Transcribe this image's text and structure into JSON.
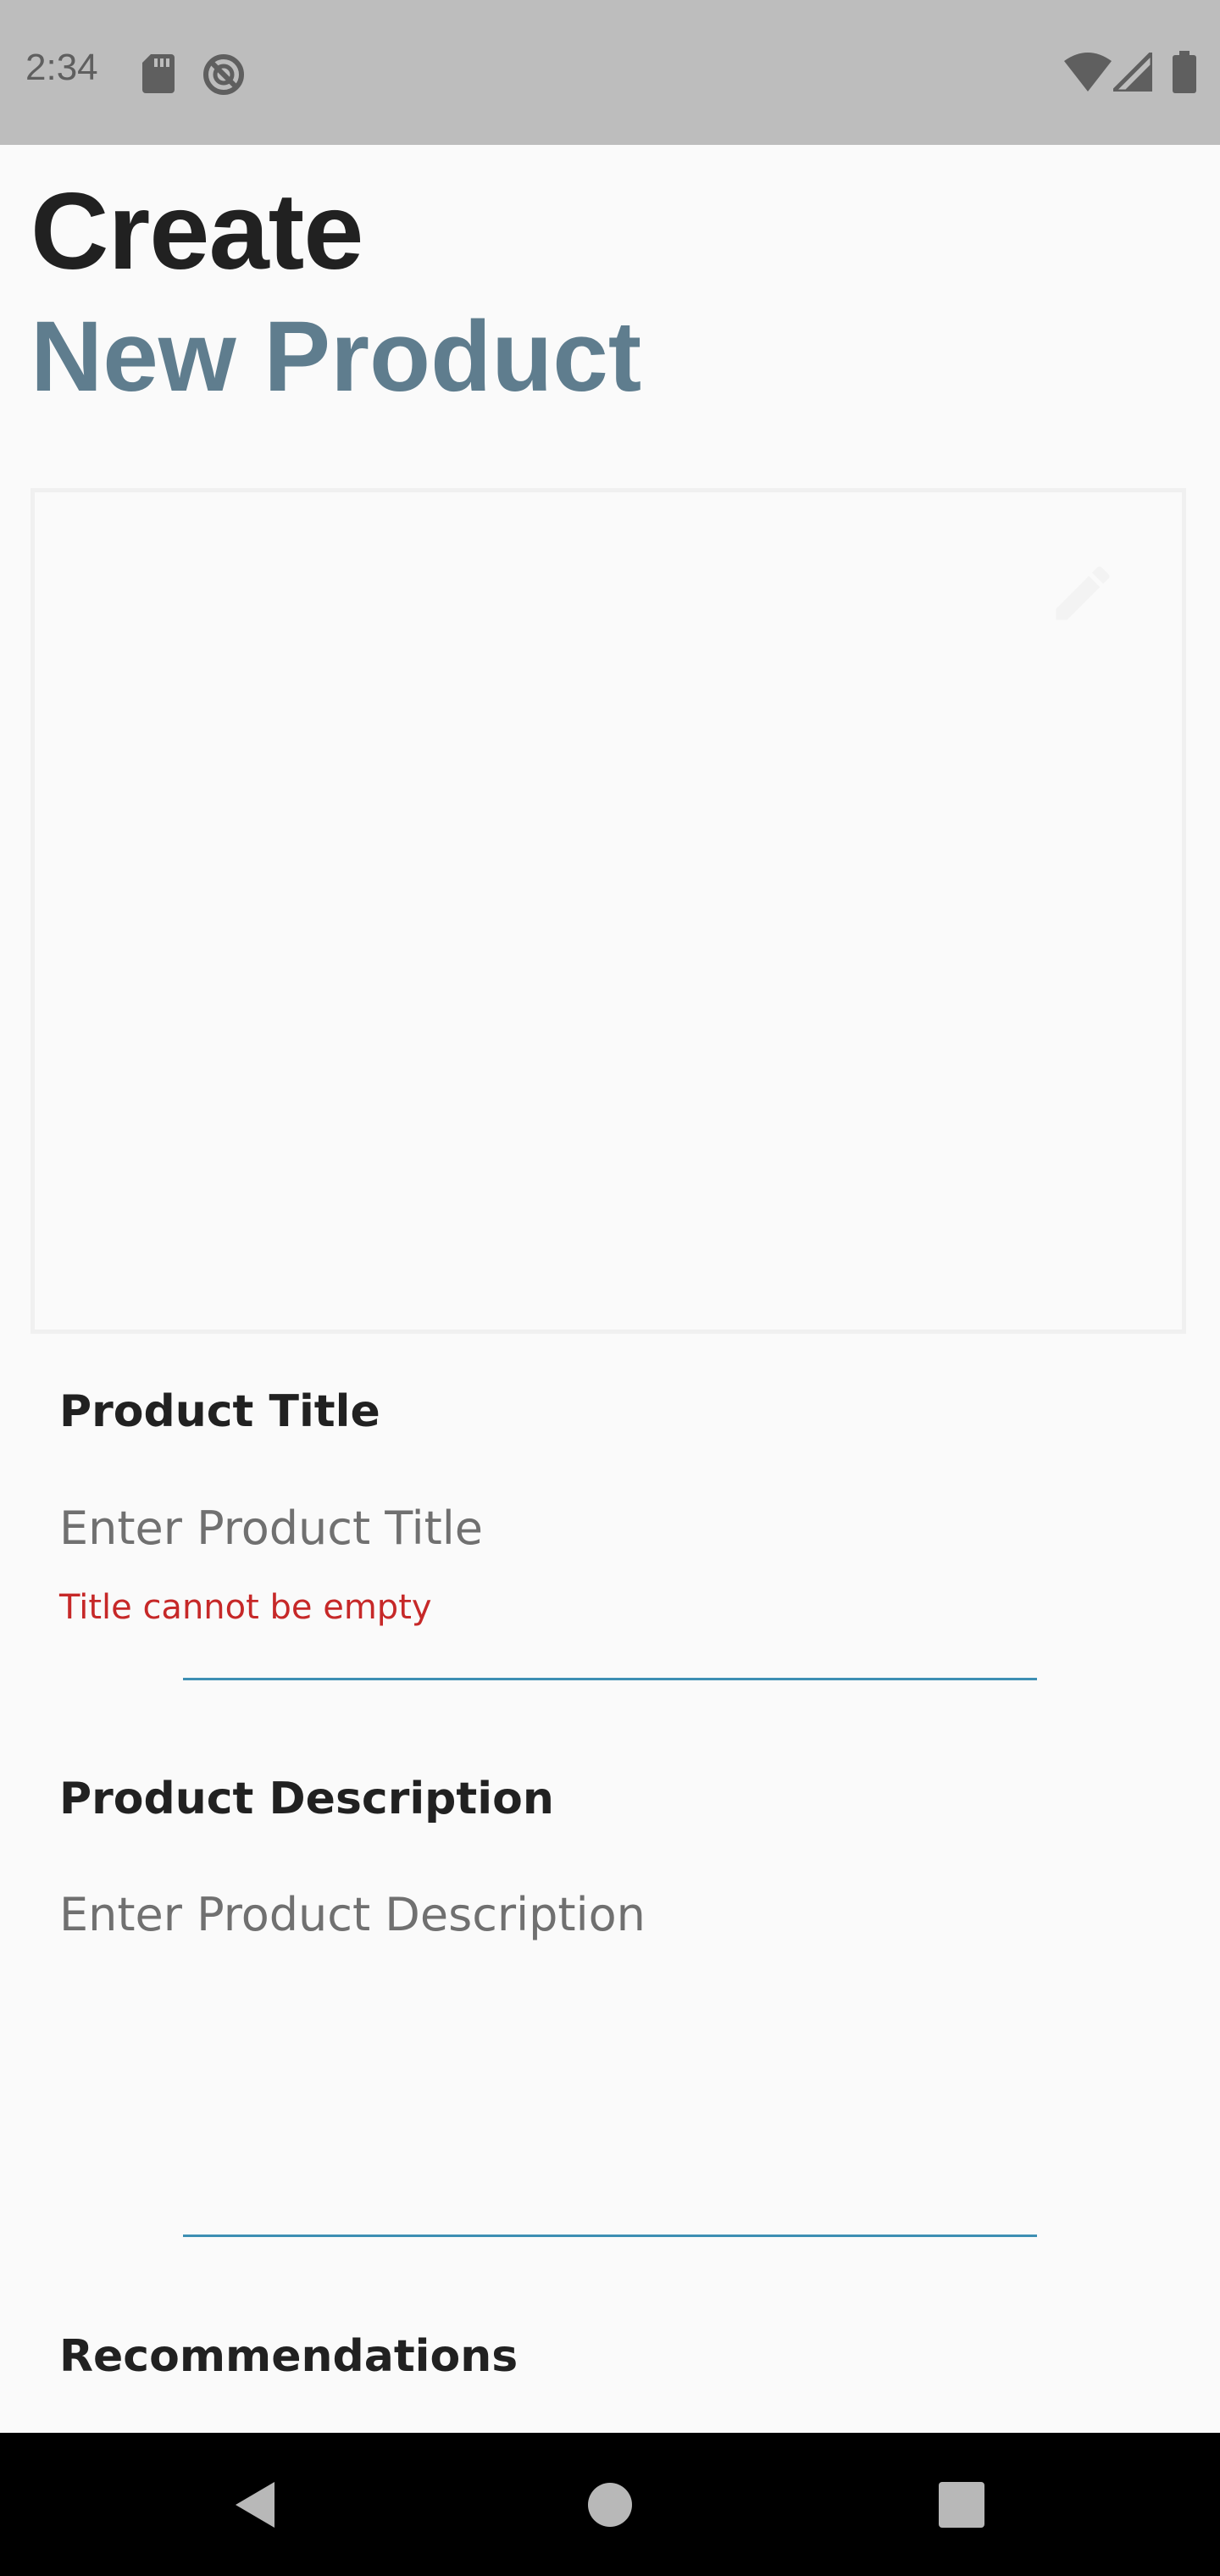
{
  "status_bar": {
    "time": "2:34",
    "icons": [
      "sd-card-icon",
      "do-not-disturb-icon",
      "wifi-icon",
      "signal-icon",
      "battery-icon"
    ]
  },
  "header": {
    "title_line1": "Create",
    "title_line2": "New Product",
    "accent_color": "#5f7d8e"
  },
  "image_picker": {
    "icon": "edit-icon"
  },
  "form": {
    "title_field": {
      "label": "Product Title",
      "placeholder": "Enter Product Title",
      "value": "",
      "error": "Title cannot be empty"
    },
    "description_field": {
      "label": "Product Description",
      "placeholder": "Enter Product Description",
      "value": ""
    },
    "recommendations_label": "Recommendations"
  },
  "colors": {
    "error": "#c62828",
    "underline": "#3d8fb3"
  },
  "nav_bar": {
    "icons": [
      "back-icon",
      "home-icon",
      "recents-icon"
    ]
  }
}
